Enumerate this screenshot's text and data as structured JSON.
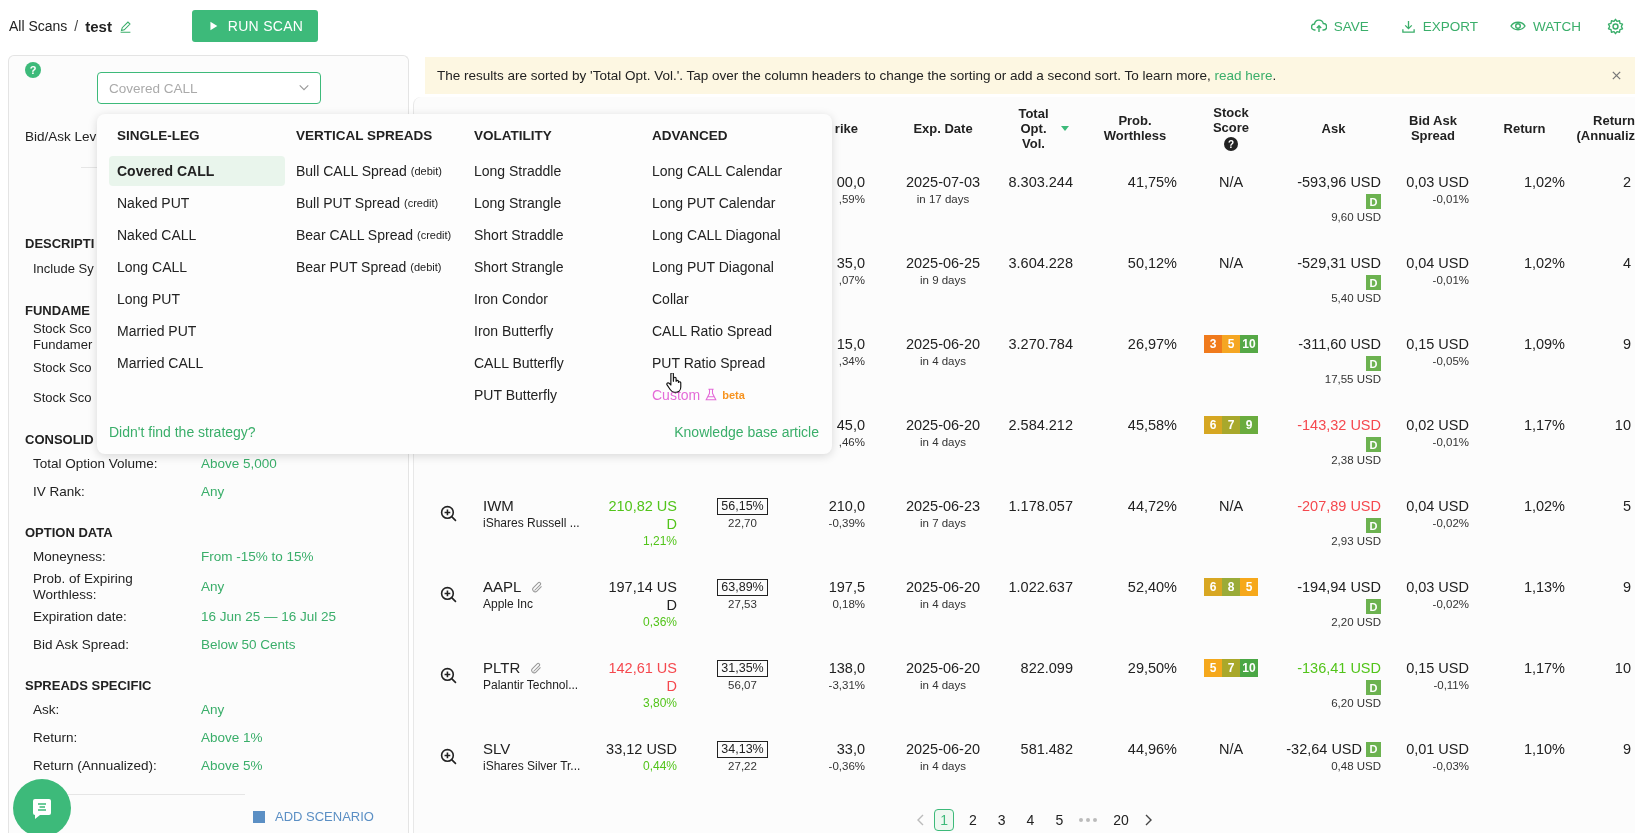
{
  "breadcrumb": {
    "root": "All Scans",
    "separator": "/",
    "current": "test"
  },
  "run_button": "RUN SCAN",
  "actions": [
    {
      "kind": "save",
      "label": "SAVE"
    },
    {
      "kind": "export",
      "label": "EXPORT"
    },
    {
      "kind": "watch",
      "label": "WATCH"
    },
    {
      "kind": "settings"
    }
  ],
  "sidebar": {
    "help": "?",
    "strategy_select": {
      "value": "Covered CALL",
      "expanded": true
    },
    "sections": [
      {
        "rows": [
          {
            "label": "Bid/Ask Lev"
          }
        ]
      },
      {
        "title": "DESCRIPTI",
        "rows": [
          {
            "label": "Include Sy"
          }
        ]
      },
      {
        "title": "FUNDAME",
        "rows": [
          {
            "label": "Stock Sco Fundamer"
          },
          {
            "label": "Stock Sco"
          },
          {
            "label": "Stock Sco"
          }
        ]
      },
      {
        "title": "CONSOLID",
        "rows": [
          {
            "label": "Total Option Volume:",
            "value": "Above 5,000"
          },
          {
            "label": "IV Rank:",
            "value": "Any"
          }
        ]
      },
      {
        "title": "OPTION DATA",
        "rows": [
          {
            "label": "Moneyness:",
            "value": "From -15% to 15%"
          },
          {
            "label": "Prob. of Expiring Worthless:",
            "value": "Any"
          },
          {
            "label": "Expiration date:",
            "value": "16 Jun 25 — 16 Jul 25"
          },
          {
            "label": "Bid Ask Spread:",
            "value": "Below 50 Cents"
          }
        ]
      },
      {
        "title": "SPREADS SPECIFIC",
        "rows": [
          {
            "label": "Ask:",
            "value": "Any"
          },
          {
            "label": "Return:",
            "value": "Above 1%"
          },
          {
            "label": "Return (Annualized):",
            "value": "Above 5%"
          }
        ]
      }
    ],
    "add_scenario": "ADD SCENARIO"
  },
  "strategy_menu": {
    "groups": [
      {
        "title": "SINGLE-LEG",
        "items": [
          {
            "label": "Covered CALL",
            "selected": true
          },
          {
            "label": "Naked PUT",
            "selected": false
          },
          {
            "label": "Naked CALL",
            "selected": false
          },
          {
            "label": "Long CALL",
            "selected": false
          },
          {
            "label": "Long PUT",
            "selected": false
          },
          {
            "label": "Married PUT",
            "selected": false
          },
          {
            "label": "Married CALL",
            "selected": false
          }
        ]
      },
      {
        "title": "VERTICAL SPREADS",
        "items": [
          {
            "label": "Bull CALL Spread",
            "note": "(debit)",
            "selected": false
          },
          {
            "label": "Bull PUT Spread",
            "note": "(credit)",
            "selected": false
          },
          {
            "label": "Bear CALL Spread",
            "note": "(credit)",
            "selected": false
          },
          {
            "label": "Bear PUT Spread",
            "note": "(debit)",
            "selected": false
          }
        ]
      },
      {
        "title": "VOLATILITY",
        "items": [
          {
            "label": "Long Straddle",
            "selected": false
          },
          {
            "label": "Long Strangle",
            "selected": false
          },
          {
            "label": "Short Straddle",
            "selected": false
          },
          {
            "label": "Short Strangle",
            "selected": false
          },
          {
            "label": "Iron Condor",
            "selected": false
          },
          {
            "label": "Iron Butterfly",
            "selected": false
          },
          {
            "label": "CALL Butterfly",
            "selected": false
          },
          {
            "label": "PUT Butterfly",
            "selected": false
          }
        ]
      },
      {
        "title": "ADVANCED",
        "items": [
          {
            "label": "Long CALL Calendar",
            "selected": false
          },
          {
            "label": "Long PUT Calendar",
            "selected": false
          },
          {
            "label": "Long CALL Diagonal",
            "selected": false
          },
          {
            "label": "Long PUT Diagonal",
            "selected": false
          },
          {
            "label": "Collar",
            "selected": false
          },
          {
            "label": "CALL Ratio Spread",
            "selected": false
          },
          {
            "label": "PUT Ratio Spread",
            "selected": false
          },
          {
            "kind": "custom",
            "label": "Custom",
            "badge": "beta",
            "selected": false
          }
        ]
      }
    ],
    "help_link": "Didn't find the strategy?",
    "kb_link": "Knowledge base article"
  },
  "banner": {
    "text": "The results are sorted by 'Total Opt. Vol.'. Tap over the column headers to change the sorting or add a second sort. To learn more, ",
    "link": "read here",
    "after": "."
  },
  "table": {
    "columns": [
      {
        "label": "rike"
      },
      {
        "label": "Exp. Date"
      },
      {
        "label": "Total Opt. Vol.",
        "sorted": true
      },
      {
        "label": "Prob. Worthless"
      },
      {
        "label": "Stock Score",
        "help": "?"
      },
      {
        "label": "Ask"
      },
      {
        "label": "Bid Ask Spread"
      },
      {
        "label": "Return"
      },
      {
        "label": "Return (Annualiz"
      }
    ],
    "rows": [
      {
        "strike": "00,0",
        "strike_sub": ",59%",
        "exp": "2025-07-03",
        "exp_sub": "in 17 days",
        "volume": "8.303.244",
        "prob": "41,75%",
        "score": "N/A",
        "ask": {
          "text": "-593,96 USD",
          "color": "#222222"
        },
        "ask_badge": "D",
        "ask_sub": "9,60 USD",
        "spread": "0,03 USD",
        "spread_sub": "-0,01%",
        "return": "1,02%",
        "annualized": "2"
      },
      {
        "strike": "35,0",
        "strike_sub": ",07%",
        "exp": "2025-06-25",
        "exp_sub": "in 9 days",
        "volume": "3.604.228",
        "prob": "50,12%",
        "score": "N/A",
        "ask": {
          "text": "-529,31 USD",
          "color": "#222222"
        },
        "ask_badge": "D",
        "ask_sub": "5,40 USD",
        "spread": "0,04 USD",
        "spread_sub": "-0,01%",
        "return": "1,02%",
        "annualized": "4"
      },
      {
        "strike": "15,0",
        "strike_sub": ",34%",
        "exp": "2025-06-20",
        "exp_sub": "in 4 days",
        "volume": "3.270.784",
        "prob": "26,97%",
        "score_chips": [
          {
            "value": "3",
            "color": "#f07a1c"
          },
          {
            "value": "5",
            "color": "#f5a623"
          },
          {
            "value": "10",
            "color": "#55a846"
          }
        ],
        "ask": {
          "text": "-311,60 USD",
          "color": "#222222"
        },
        "ask_badge": "D",
        "ask_sub": "17,55 USD",
        "spread": "0,15 USD",
        "spread_sub": "-0,05%",
        "return": "1,09%",
        "annualized": "9"
      },
      {
        "strike": "45,0",
        "strike_sub": ",46%",
        "exp": "2025-06-20",
        "exp_sub": "in 4 days",
        "volume": "2.584.212",
        "prob": "45,58%",
        "score_chips": [
          {
            "value": "6",
            "color": "#d6a722"
          },
          {
            "value": "7",
            "color": "#a8a82c"
          },
          {
            "value": "9",
            "color": "#6aac3e"
          }
        ],
        "ask": {
          "text": "-143,32 USD",
          "color": "#f5484e"
        },
        "ask_badge": "D",
        "ask_sub": "2,38 USD",
        "spread": "0,02 USD",
        "spread_sub": "-0,01%",
        "return": "1,17%",
        "annualized": "10"
      },
      {
        "symbol": "IWM",
        "linked": false,
        "name": "iShares Russell ...",
        "price": {
          "text": "210,82 USD",
          "color": "#52c41a"
        },
        "change": {
          "text": "1,21%",
          "color": "#52c41a"
        },
        "iv": "56,15%",
        "iv_sub": "22,70",
        "strike": "210,0",
        "strike_sub": "-0,39%",
        "exp": "2025-06-23",
        "exp_sub": "in 7 days",
        "volume": "1.178.057",
        "prob": "44,72%",
        "score": "N/A",
        "ask": {
          "text": "-207,89 USD",
          "color": "#f5484e"
        },
        "ask_badge": "D",
        "ask_sub": "2,93 USD",
        "spread": "0,04 USD",
        "spread_sub": "-0,02%",
        "return": "1,02%",
        "annualized": "5"
      },
      {
        "symbol": "AAPL",
        "linked": true,
        "name": "Apple Inc",
        "price": {
          "text": "197,14 USD",
          "color": "#222222"
        },
        "change": {
          "text": "0,36%",
          "color": "#52c41a"
        },
        "iv": "63,89%",
        "iv_sub": "27,53",
        "strike": "197,5",
        "strike_sub": "0,18%",
        "exp": "2025-06-20",
        "exp_sub": "in 4 days",
        "volume": "1.022.637",
        "prob": "52,40%",
        "score_chips": [
          {
            "value": "6",
            "color": "#d8a722"
          },
          {
            "value": "8",
            "color": "#9aab38"
          },
          {
            "value": "5",
            "color": "#f6a81b"
          }
        ],
        "ask": {
          "text": "-194,94 USD",
          "color": "#222222"
        },
        "ask_badge": "D",
        "ask_sub": "2,20 USD",
        "spread": "0,03 USD",
        "spread_sub": "-0,02%",
        "return": "1,13%",
        "annualized": "9"
      },
      {
        "symbol": "PLTR",
        "linked": true,
        "name": "Palantir Technol...",
        "price": {
          "text": "142,61 USD",
          "color": "#f5484e"
        },
        "change": {
          "text": "3,80%",
          "color": "#52c41a"
        },
        "iv": "31,35%",
        "iv_sub": "56,07",
        "strike": "138,0",
        "strike_sub": "-3,31%",
        "exp": "2025-06-20",
        "exp_sub": "in 4 days",
        "volume": "822.099",
        "prob": "29,50%",
        "score_chips": [
          {
            "value": "5",
            "color": "#f5a81c"
          },
          {
            "value": "7",
            "color": "#a9a82a"
          },
          {
            "value": "10",
            "color": "#4aa745"
          }
        ],
        "ask": {
          "text": "-136,41 USD",
          "color": "#52c41a"
        },
        "ask_badge": "D",
        "ask_sub": "6,20 USD",
        "spread": "0,15 USD",
        "spread_sub": "-0,11%",
        "return": "1,17%",
        "annualized": "10"
      },
      {
        "symbol": "SLV",
        "linked": false,
        "name": "iShares Silver Tr...",
        "price": {
          "text": "33,12 USD",
          "color": "#222222"
        },
        "change": {
          "text": "0,44%",
          "color": "#52c41a"
        },
        "iv": "34,13%",
        "iv_sub": "27,22",
        "strike": "33,0",
        "strike_sub": "-0,36%",
        "exp": "2025-06-20",
        "exp_sub": "in 4 days",
        "volume": "581.482",
        "prob": "44,96%",
        "score": "N/A",
        "ask": {
          "text": "-32,64 USD",
          "color": "#222222"
        },
        "ask_badge": "D",
        "ask_sub": "0,48 USD",
        "spread": "0,01 USD",
        "spread_sub": "-0,03%",
        "return": "1,10%",
        "annualized": "9"
      }
    ]
  },
  "pagination": {
    "pages": [
      {
        "kind": "page",
        "label": "1",
        "selected": true
      },
      {
        "kind": "page",
        "label": "2",
        "selected": false
      },
      {
        "kind": "page",
        "label": "3",
        "selected": false
      },
      {
        "kind": "page",
        "label": "4",
        "selected": false
      },
      {
        "kind": "page",
        "label": "5",
        "selected": false
      },
      {
        "kind": "gap"
      },
      {
        "kind": "page",
        "label": "20",
        "selected": false
      }
    ]
  }
}
